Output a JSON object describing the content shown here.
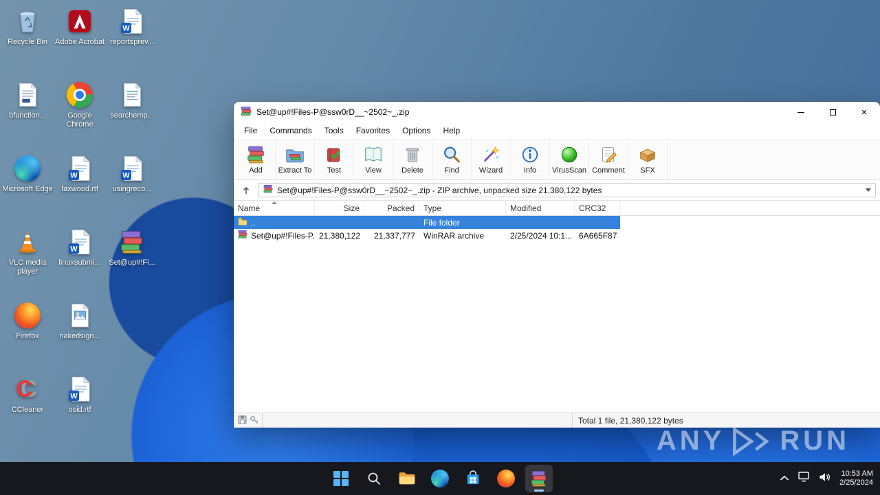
{
  "desktop": {
    "icons": [
      {
        "label": "Recycle Bin"
      },
      {
        "label": "Adobe Acrobat"
      },
      {
        "label": "reportsprev..."
      },
      {
        "label": "bfunction..."
      },
      {
        "label": "Google Chrome"
      },
      {
        "label": "searchemp..."
      },
      {
        "label": "Microsoft Edge"
      },
      {
        "label": "faxwood.rtf"
      },
      {
        "label": "usingreco..."
      },
      {
        "label": "VLC media player"
      },
      {
        "label": "linuxsubmi..."
      },
      {
        "label": "Set@up#!Fi..."
      },
      {
        "label": "Firefox"
      },
      {
        "label": "nakedsign..."
      },
      {
        "label": "CCleaner"
      },
      {
        "label": "osid.rtf"
      }
    ]
  },
  "window": {
    "title": "Set@up#!Files-P@ssw0rD__~2502~_.zip",
    "menu": [
      "File",
      "Commands",
      "Tools",
      "Favorites",
      "Options",
      "Help"
    ],
    "toolbar": [
      "Add",
      "Extract To",
      "Test",
      "View",
      "Delete",
      "Find",
      "Wizard",
      "Info",
      "VirusScan",
      "Comment",
      "SFX"
    ],
    "address": "Set@up#!Files-P@ssw0rD__~2502~_.zip - ZIP archive, unpacked size 21,380,122 bytes",
    "columns": [
      "Name",
      "Size",
      "Packed",
      "Type",
      "Modified",
      "CRC32"
    ],
    "rows": [
      {
        "name": "..",
        "size": "",
        "packed": "",
        "type": "File folder",
        "modified": "",
        "crc32": ""
      },
      {
        "name": "Set@up#!Files-P...",
        "size": "21,380,122",
        "packed": "21,337,777",
        "type": "WinRAR archive",
        "modified": "2/25/2024 10:1...",
        "crc32": "6A665F87"
      }
    ],
    "status": "Total 1 file, 21,380,122 bytes"
  },
  "taskbar": {
    "time": "10:53 AM",
    "date": "2/25/2024"
  },
  "watermark": {
    "left": "ANY",
    "right": "RUN"
  },
  "colors": {
    "selection": "#3583dd",
    "taskbar": "#16181d",
    "wallpaper_accent": "#1c62d6"
  }
}
